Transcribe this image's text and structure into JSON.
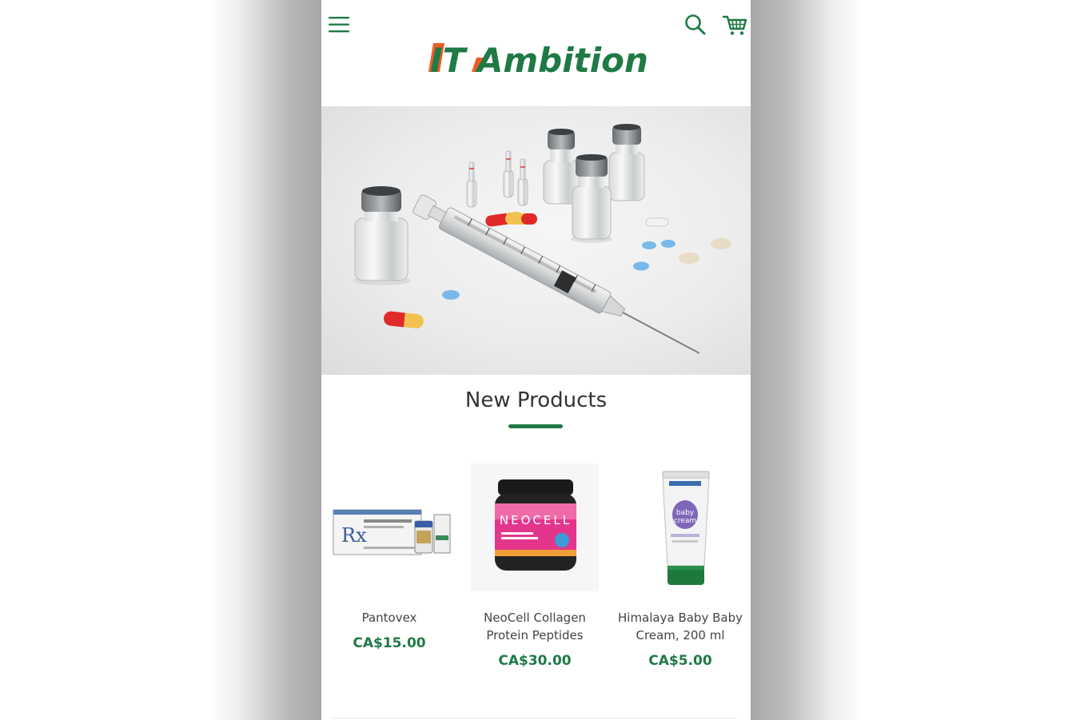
{
  "header": {
    "logo_text": "IT Ambition",
    "menu_icon": "hamburger-menu-icon",
    "search_icon": "search-icon",
    "cart_icon": "shopping-cart-icon"
  },
  "hero": {
    "image_description_icon": "medical-syringe-vials-pills-image"
  },
  "new_products": {
    "title": "New Products",
    "items": [
      {
        "name": "Pantovex",
        "price": "CA$15.00"
      },
      {
        "name": "NeoCell Collagen Protein Peptides",
        "price": "CA$30.00"
      },
      {
        "name": "Himalaya Baby Baby Cream, 200 ml",
        "price": "CA$5.00"
      }
    ]
  },
  "colors": {
    "brand_green": "#1f7a45",
    "brand_orange": "#ef5a28",
    "text_dark": "#333333"
  }
}
